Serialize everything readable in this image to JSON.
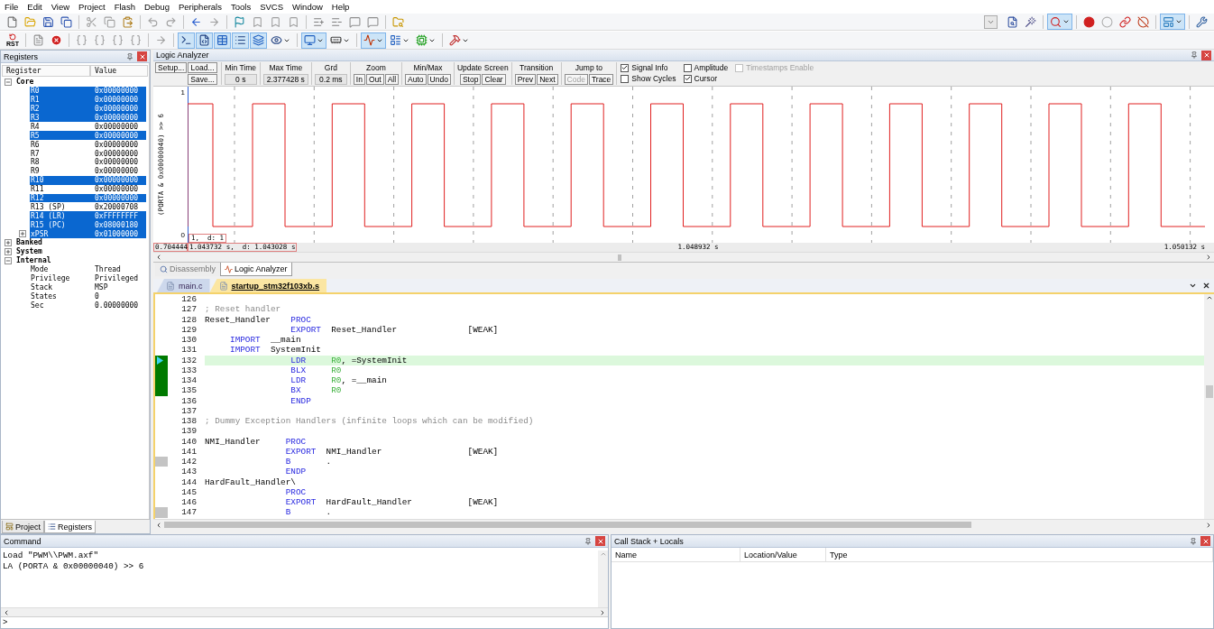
{
  "menu": [
    "File",
    "Edit",
    "View",
    "Project",
    "Flash",
    "Debug",
    "Peripherals",
    "Tools",
    "SVCS",
    "Window",
    "Help"
  ],
  "toolbars": [
    {
      "items": [
        {
          "kind": "button",
          "pressed": false,
          "dropdown": false
        },
        {
          "kind": "button",
          "pressed": false,
          "dropdown": false
        },
        {
          "kind": "button",
          "pressed": false,
          "dropdown": false
        },
        {
          "kind": "button",
          "pressed": false,
          "dropdown": false
        },
        {
          "kind": "separator"
        },
        {
          "kind": "button",
          "pressed": false,
          "dropdown": false
        },
        {
          "kind": "button",
          "pressed": false,
          "dropdown": false
        },
        {
          "kind": "button",
          "pressed": false,
          "dropdown": false
        },
        {
          "kind": "separator"
        },
        {
          "kind": "button",
          "pressed": false,
          "dropdown": false
        },
        {
          "kind": "button",
          "pressed": false,
          "dropdown": false
        },
        {
          "kind": "separator"
        },
        {
          "kind": "button",
          "pressed": false,
          "dropdown": false
        },
        {
          "kind": "button",
          "pressed": false,
          "dropdown": false
        },
        {
          "kind": "separator"
        },
        {
          "kind": "button",
          "pressed": false,
          "dropdown": false
        },
        {
          "kind": "button",
          "pressed": false,
          "dropdown": false
        },
        {
          "kind": "button",
          "pressed": false,
          "dropdown": false
        },
        {
          "kind": "button",
          "pressed": false,
          "dropdown": false
        },
        {
          "kind": "separator"
        },
        {
          "kind": "button",
          "pressed": false,
          "dropdown": false
        },
        {
          "kind": "button",
          "pressed": false,
          "dropdown": false
        },
        {
          "kind": "button",
          "pressed": false,
          "dropdown": false
        },
        {
          "kind": "button",
          "pressed": false,
          "dropdown": false
        },
        {
          "kind": "separator"
        },
        {
          "kind": "button",
          "pressed": false,
          "dropdown": false
        },
        {
          "kind": "spacer"
        },
        {
          "kind": "combo"
        },
        {
          "kind": "button",
          "pressed": false,
          "dropdown": false
        },
        {
          "kind": "button",
          "pressed": false,
          "dropdown": false
        },
        {
          "kind": "separator"
        },
        {
          "kind": "button",
          "pressed": true,
          "dropdown": true
        },
        {
          "kind": "separator"
        },
        {
          "kind": "button",
          "pressed": false,
          "dropdown": false
        },
        {
          "kind": "button",
          "pressed": false,
          "dropdown": false
        },
        {
          "kind": "button",
          "pressed": false,
          "dropdown": false
        },
        {
          "kind": "button",
          "pressed": false,
          "dropdown": false
        },
        {
          "kind": "separator"
        },
        {
          "kind": "button",
          "pressed": true,
          "dropdown": true
        },
        {
          "kind": "separator"
        },
        {
          "kind": "button",
          "pressed": false,
          "dropdown": false
        }
      ]
    },
    {
      "items": [
        {
          "kind": "button",
          "pressed": false,
          "dropdown": false,
          "label": "RST"
        },
        {
          "kind": "separator"
        },
        {
          "kind": "button",
          "pressed": false,
          "dropdown": false
        },
        {
          "kind": "button",
          "pressed": false,
          "dropdown": false
        },
        {
          "kind": "separator"
        },
        {
          "kind": "button",
          "pressed": false,
          "dropdown": false
        },
        {
          "kind": "button",
          "pressed": false,
          "dropdown": false
        },
        {
          "kind": "button",
          "pressed": false,
          "dropdown": false
        },
        {
          "kind": "button",
          "pressed": false,
          "dropdown": false
        },
        {
          "kind": "separator"
        },
        {
          "kind": "button",
          "pressed": false,
          "dropdown": false
        },
        {
          "kind": "separator"
        },
        {
          "kind": "button",
          "pressed": true,
          "dropdown": false
        },
        {
          "kind": "button",
          "pressed": true,
          "dropdown": false
        },
        {
          "kind": "button",
          "pressed": true,
          "dropdown": false
        },
        {
          "kind": "button",
          "pressed": true,
          "dropdown": false
        },
        {
          "kind": "button",
          "pressed": true,
          "dropdown": false
        },
        {
          "kind": "button",
          "pressed": false,
          "dropdown": true
        },
        {
          "kind": "separator"
        },
        {
          "kind": "button",
          "pressed": true,
          "dropdown": true
        },
        {
          "kind": "button",
          "pressed": false,
          "dropdown": true
        },
        {
          "kind": "separator"
        },
        {
          "kind": "button",
          "pressed": true,
          "dropdown": true
        },
        {
          "kind": "button",
          "pressed": false,
          "dropdown": true
        },
        {
          "kind": "button",
          "pressed": false,
          "dropdown": true
        },
        {
          "kind": "separator"
        },
        {
          "kind": "button",
          "pressed": false,
          "dropdown": true
        }
      ]
    }
  ],
  "registers": {
    "title": "Registers",
    "columns": [
      "Register",
      "Value"
    ],
    "tree": [
      {
        "name": "Core",
        "expanded": true,
        "selected": false,
        "children": [
          {
            "name": "R0",
            "value": "0x00000000",
            "selected": true
          },
          {
            "name": "R1",
            "value": "0x00000000",
            "selected": true
          },
          {
            "name": "R2",
            "value": "0x00000000",
            "selected": true
          },
          {
            "name": "R3",
            "value": "0x00000000",
            "selected": true
          },
          {
            "name": "R4",
            "value": "0x00000000",
            "selected": false
          },
          {
            "name": "R5",
            "value": "0x00000000",
            "selected": true
          },
          {
            "name": "R6",
            "value": "0x00000000",
            "selected": false
          },
          {
            "name": "R7",
            "value": "0x00000000",
            "selected": false
          },
          {
            "name": "R8",
            "value": "0x00000000",
            "selected": false
          },
          {
            "name": "R9",
            "value": "0x00000000",
            "selected": false
          },
          {
            "name": "R10",
            "value": "0x00000000",
            "selected": true
          },
          {
            "name": "R11",
            "value": "0x00000000",
            "selected": false
          },
          {
            "name": "R12",
            "value": "0x00000000",
            "selected": true
          },
          {
            "name": "R13 (SP)",
            "value": "0x20000708",
            "selected": false
          },
          {
            "name": "R14 (LR)",
            "value": "0xFFFFFFFF",
            "selected": true
          },
          {
            "name": "R15 (PC)",
            "value": "0x08000180",
            "selected": true
          },
          {
            "name": "xPSR",
            "value": "0x01000000",
            "selected": true,
            "expanded": false
          }
        ]
      },
      {
        "name": "Banked",
        "expanded": false,
        "selected": false
      },
      {
        "name": "System",
        "expanded": false,
        "selected": false
      },
      {
        "name": "Internal",
        "expanded": true,
        "selected": false,
        "children": [
          {
            "name": "Mode",
            "value": "Thread",
            "selected": false
          },
          {
            "name": "Privilege",
            "value": "Privileged",
            "selected": false
          },
          {
            "name": "Stack",
            "value": "MSP",
            "selected": false
          },
          {
            "name": "States",
            "value": "0",
            "selected": false
          },
          {
            "name": "Sec",
            "value": "0.00000000",
            "selected": false
          }
        ]
      }
    ]
  },
  "left_tabs": [
    {
      "label": "Project",
      "selected": false
    },
    {
      "label": "Registers",
      "selected": true
    }
  ],
  "logic_analyzer": {
    "title": "Logic Analyzer",
    "file_buttons": [
      {
        "label": "Setup..."
      },
      {
        "label": "Load..."
      },
      {
        "label": "Save..."
      }
    ],
    "readouts": [
      {
        "label": "Min Time",
        "value": "0 s"
      },
      {
        "label": "Max Time",
        "value": "2.377428 s"
      },
      {
        "label": "Grd",
        "value": "0.2 ms"
      }
    ],
    "button_groups": [
      {
        "label": "Zoom",
        "buttons": [
          {
            "label": "In",
            "disabled": false
          },
          {
            "label": "Out",
            "disabled": false
          },
          {
            "label": "All",
            "disabled": false
          }
        ]
      },
      {
        "label": "Min/Max",
        "buttons": [
          {
            "label": "Auto",
            "disabled": false
          },
          {
            "label": "Undo",
            "disabled": false
          }
        ]
      },
      {
        "label": "Update Screen",
        "buttons": [
          {
            "label": "Stop",
            "disabled": false
          },
          {
            "label": "Clear",
            "disabled": false
          }
        ]
      },
      {
        "label": "Transition",
        "buttons": [
          {
            "label": "Prev",
            "disabled": false
          },
          {
            "label": "Next",
            "disabled": false
          }
        ]
      },
      {
        "label": "Jump to",
        "buttons": [
          {
            "label": "Code",
            "disabled": true
          },
          {
            "label": "Trace",
            "disabled": false
          }
        ]
      }
    ],
    "options": [
      {
        "label": "Signal Info",
        "checked": true,
        "disabled": false
      },
      {
        "label": "Show Cycles",
        "checked": false,
        "disabled": false
      },
      {
        "label": "Amplitude",
        "checked": false,
        "disabled": false
      },
      {
        "label": "Cursor",
        "checked": true,
        "disabled": false
      },
      {
        "label": "Timestamps Enable",
        "checked": false,
        "disabled": true
      }
    ],
    "signal": {
      "label": "(PORTA & 0x00000040) >> 6",
      "y_max": "1",
      "y_min": "0",
      "cursor_value": "1,  d: 1"
    },
    "time_labels": {
      "start": "0.704444",
      "cursor": "1.043732 s,  d: 1.043028 s",
      "center": "1.048932 s",
      "end": "1.050132 s"
    }
  },
  "window_tabs": [
    {
      "label": "Disassembly",
      "selected": false
    },
    {
      "label": "Logic Analyzer",
      "selected": true
    }
  ],
  "editor": {
    "tabs": [
      {
        "label": "main.c",
        "selected": false
      },
      {
        "label": "startup_stm32f103xb.s",
        "selected": true
      }
    ],
    "lines": [
      {
        "number": "126",
        "current": false,
        "kind": "plain"
      },
      {
        "number": "127",
        "current": false,
        "kind": "plain",
        "segments": [
          {
            "text": "; Reset handler",
            "kind": "comment"
          }
        ]
      },
      {
        "number": "128",
        "current": false,
        "kind": "plain",
        "segments": [
          {
            "text": "Reset_Handler    ",
            "kind": "plain"
          },
          {
            "text": "PROC",
            "kind": "keyword"
          }
        ]
      },
      {
        "number": "129",
        "current": false,
        "kind": "plain",
        "segments": [
          {
            "text": "                 EXPORT",
            "kind": "keyword"
          },
          {
            "text": "  Reset_Handler              [WEAK]",
            "kind": "plain"
          }
        ]
      },
      {
        "number": "130",
        "current": false,
        "kind": "plain",
        "segments": [
          {
            "text": "     IMPORT",
            "kind": "keyword"
          },
          {
            "text": "  __main",
            "kind": "plain"
          }
        ]
      },
      {
        "number": "131",
        "current": false,
        "kind": "plain",
        "segments": [
          {
            "text": "     IMPORT",
            "kind": "keyword"
          },
          {
            "text": "  SystemInit",
            "kind": "plain"
          }
        ]
      },
      {
        "number": "132",
        "current": true,
        "kind": "executed",
        "segments": [
          {
            "text": "                 LDR",
            "kind": "keyword"
          },
          {
            "text": "     R0",
            "kind": "register"
          },
          {
            "text": ", =SystemInit",
            "kind": "plain"
          }
        ]
      },
      {
        "number": "133",
        "current": false,
        "kind": "executed",
        "segments": [
          {
            "text": "                 BLX",
            "kind": "keyword"
          },
          {
            "text": "     R0",
            "kind": "register"
          }
        ]
      },
      {
        "number": "134",
        "current": false,
        "kind": "executed",
        "segments": [
          {
            "text": "                 LDR",
            "kind": "keyword"
          },
          {
            "text": "     R0",
            "kind": "register"
          },
          {
            "text": ", =__main",
            "kind": "plain"
          }
        ]
      },
      {
        "number": "135",
        "current": false,
        "kind": "executed",
        "segments": [
          {
            "text": "                 BX",
            "kind": "keyword"
          },
          {
            "text": "      R0",
            "kind": "register"
          }
        ]
      },
      {
        "number": "136",
        "current": false,
        "kind": "plain",
        "segments": [
          {
            "text": "                 ENDP",
            "kind": "keyword"
          }
        ]
      },
      {
        "number": "137",
        "current": false,
        "kind": "plain"
      },
      {
        "number": "138",
        "current": false,
        "kind": "plain",
        "segments": [
          {
            "text": "; Dummy Exception Handlers (infinite loops which can be modified)",
            "kind": "comment"
          }
        ]
      },
      {
        "number": "139",
        "current": false,
        "kind": "plain"
      },
      {
        "number": "140",
        "current": false,
        "kind": "plain",
        "segments": [
          {
            "text": "NMI_Handler     ",
            "kind": "plain"
          },
          {
            "text": "PROC",
            "kind": "keyword"
          }
        ]
      },
      {
        "number": "141",
        "current": false,
        "kind": "plain",
        "segments": [
          {
            "text": "                EXPORT",
            "kind": "keyword"
          },
          {
            "text": "  NMI_Handler                 [WEAK]",
            "kind": "plain"
          }
        ]
      },
      {
        "number": "142",
        "current": false,
        "kind": "skipped",
        "segments": [
          {
            "text": "                B",
            "kind": "keyword"
          },
          {
            "text": "       .",
            "kind": "plain"
          }
        ]
      },
      {
        "number": "143",
        "current": false,
        "kind": "plain",
        "segments": [
          {
            "text": "                ENDP",
            "kind": "keyword"
          }
        ]
      },
      {
        "number": "144",
        "current": false,
        "kind": "plain",
        "segments": [
          {
            "text": "HardFault_Handler\\",
            "kind": "plain"
          }
        ]
      },
      {
        "number": "145",
        "current": false,
        "kind": "plain",
        "segments": [
          {
            "text": "                PROC",
            "kind": "keyword"
          }
        ]
      },
      {
        "number": "146",
        "current": false,
        "kind": "plain",
        "segments": [
          {
            "text": "                EXPORT",
            "kind": "keyword"
          },
          {
            "text": "  HardFault_Handler           [WEAK]",
            "kind": "plain"
          }
        ]
      },
      {
        "number": "147",
        "current": false,
        "kind": "skipped",
        "segments": [
          {
            "text": "                B",
            "kind": "keyword"
          },
          {
            "text": "       .",
            "kind": "plain"
          }
        ]
      }
    ]
  },
  "command": {
    "title": "Command",
    "lines": [
      "Load \"PWM\\\\PWM.axf\"",
      "LA (PORTA & 0x00000040) >> 6"
    ],
    "prompt": ">"
  },
  "call_stack": {
    "title": "Call Stack + Locals",
    "columns": [
      "Name",
      "Location/Value",
      "Type"
    ]
  }
}
